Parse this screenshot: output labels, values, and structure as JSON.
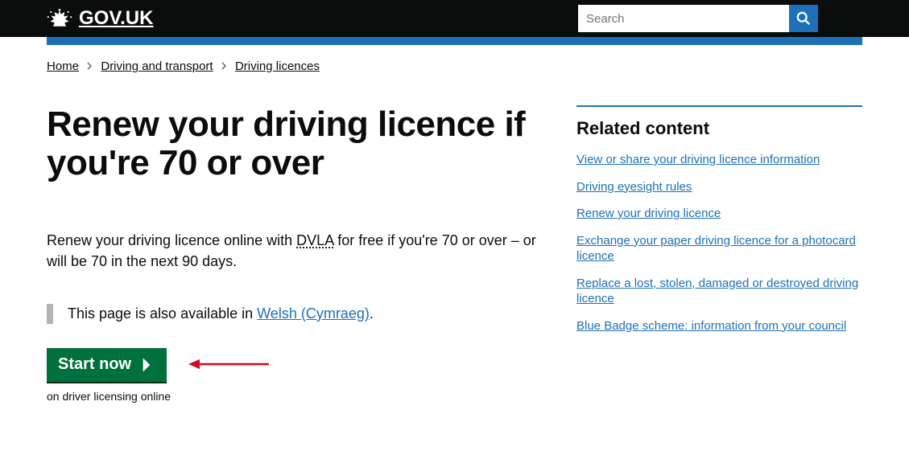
{
  "header": {
    "logo_text": "GOV.UK",
    "search_placeholder": "Search"
  },
  "breadcrumbs": [
    {
      "label": "Home"
    },
    {
      "label": "Driving and transport"
    },
    {
      "label": "Driving licences"
    }
  ],
  "main": {
    "title": "Renew your driving licence if you're 70 or over",
    "intro_pre": "Renew your driving licence online with ",
    "intro_abbr": "DVLA",
    "intro_post": " for free if you're 70 or over – or will be 70 in the next 90 days.",
    "inset_pre": "This page is also available in ",
    "inset_link": "Welsh (Cymraeg)",
    "inset_post": ".",
    "start_label": "Start now",
    "start_sub": "on driver licensing online"
  },
  "sidebar": {
    "heading": "Related content",
    "links": [
      "View or share your driving licence information",
      "Driving eyesight rules",
      "Renew your driving licence",
      "Exchange your paper driving licence for a photocard licence",
      "Replace a lost, stolen, damaged or destroyed driving licence",
      "Blue Badge scheme: information from your council"
    ]
  }
}
